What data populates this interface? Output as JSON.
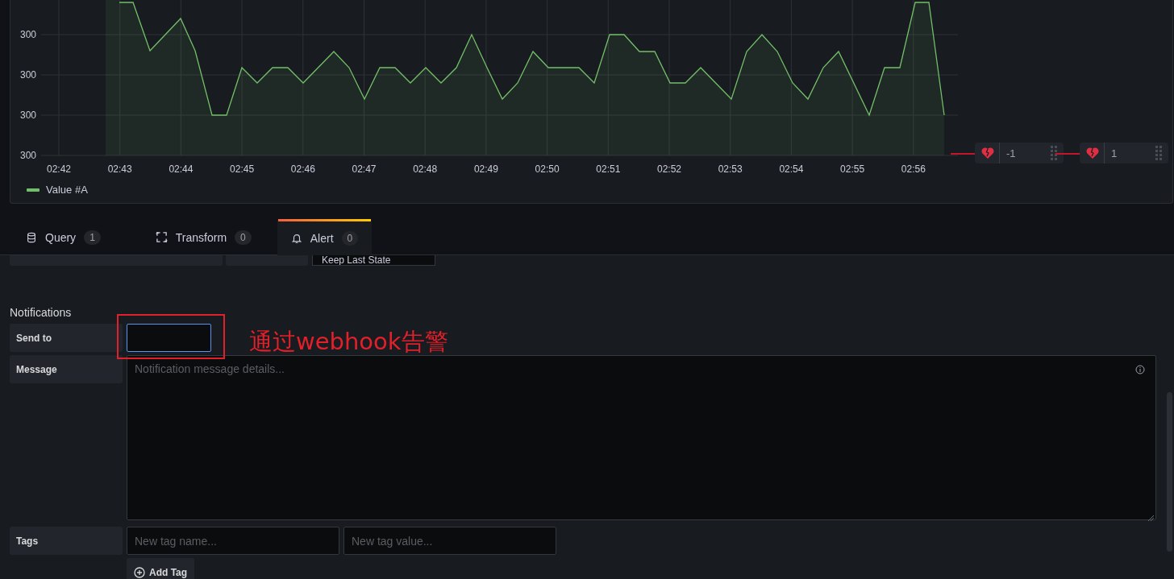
{
  "chart": {
    "y_ticks": [
      "300",
      "300",
      "300",
      "300"
    ],
    "x_ticks": [
      "02:42",
      "02:43",
      "02:44",
      "02:45",
      "02:46",
      "02:47",
      "02:48",
      "02:49",
      "02:50",
      "02:51",
      "02:52",
      "02:53",
      "02:54",
      "02:55",
      "02:56"
    ],
    "legend": [
      {
        "label": "Value #A"
      }
    ],
    "thresholds": [
      {
        "value": "-1"
      },
      {
        "value": "1"
      }
    ]
  },
  "tabs": [
    {
      "label": "Query",
      "count": "1",
      "selected": false,
      "kind": "query"
    },
    {
      "label": "Transform",
      "count": "0",
      "selected": false,
      "kind": "transform"
    },
    {
      "label": "Alert",
      "count": "0",
      "selected": true,
      "kind": "alert"
    }
  ],
  "partial_row": {
    "value": "Keep Last State"
  },
  "notifications": {
    "title": "Notifications",
    "send_to": {
      "label": "Send to",
      "focused": true
    },
    "message": {
      "label": "Message",
      "placeholder": "Notification message details..."
    },
    "tags": {
      "label": "Tags",
      "name_placeholder": "New tag name...",
      "value_placeholder": "New tag value..."
    },
    "add_tag": "Add Tag"
  },
  "annotation": {
    "text": "通过webhook告警"
  }
}
